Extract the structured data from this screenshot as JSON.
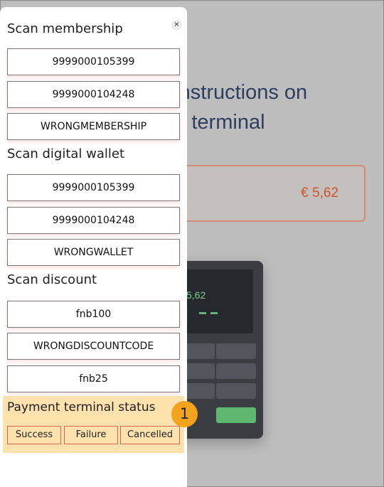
{
  "background": {
    "instructions_line1": "e instructions on",
    "instructions_line2": "ent terminal",
    "amount": "€ 5,62",
    "terminal_amount": "5,62"
  },
  "panel": {
    "close_label": "×",
    "membership": {
      "title": "Scan membership",
      "items": [
        "9999000105399",
        "9999000104248",
        "WRONGMEMBERSHIP"
      ]
    },
    "wallet": {
      "title": "Scan digital wallet",
      "items": [
        "9999000105399",
        "9999000104248",
        "WRONGWALLET"
      ]
    },
    "discount": {
      "title": "Scan discount",
      "items": [
        "fnb100",
        "WRONGDISCOUNTCODE",
        "fnb25"
      ]
    },
    "status": {
      "title": "Payment terminal status",
      "buttons": [
        "Success",
        "Failure",
        "Cancelled"
      ]
    }
  },
  "badge": "1",
  "colors": {
    "status_bg": "#fde2ad",
    "status_border": "#d9634d",
    "badge": "#f3a31c",
    "amount_text": "#d0512e"
  }
}
